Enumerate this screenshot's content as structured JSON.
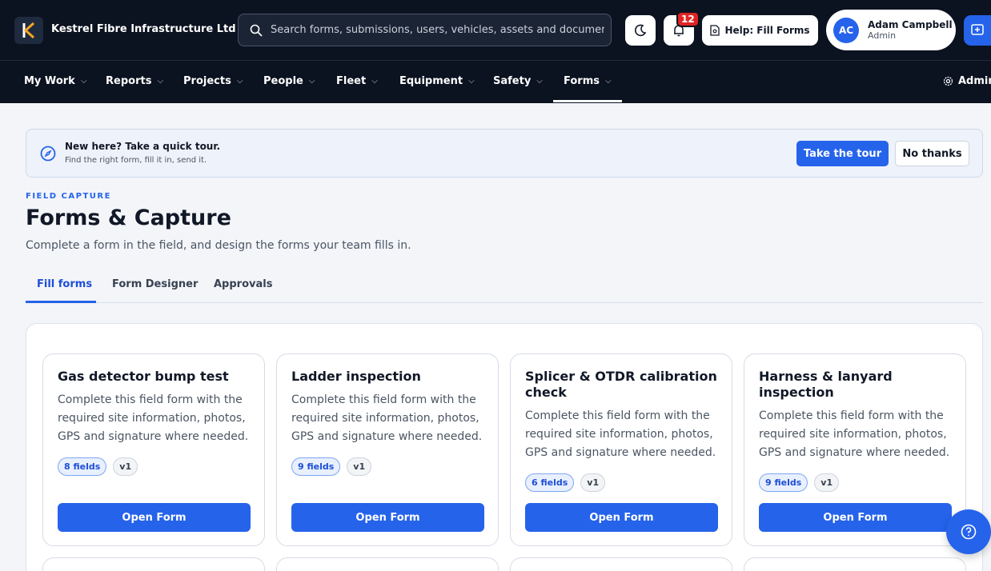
{
  "header": {
    "company": "Kestrel Fibre Infrastructure Ltd",
    "logo_letter": "K",
    "search_placeholder": "Search forms, submissions, users, vehicles, assets and documents",
    "notification_count": "12",
    "help_label": "Help: Fill Forms",
    "user": {
      "initials": "AC",
      "name": "Adam Campbell",
      "role": "Admin"
    }
  },
  "nav": {
    "items": [
      {
        "label": "My Work"
      },
      {
        "label": "Reports"
      },
      {
        "label": "Projects"
      },
      {
        "label": "People"
      },
      {
        "label": "Fleet"
      },
      {
        "label": "Equipment"
      },
      {
        "label": "Safety"
      },
      {
        "label": "Forms"
      }
    ],
    "active": "Forms",
    "admin_label": "Admin"
  },
  "banner": {
    "title": "New here? Take a quick tour.",
    "subtitle": "Find the right form, fill it in, send it.",
    "primary": "Take the tour",
    "secondary": "No thanks"
  },
  "page": {
    "eyebrow": "FIELD CAPTURE",
    "title": "Forms & Capture",
    "subtitle": "Complete a form in the field, and design the forms your team fills in."
  },
  "tabs": [
    {
      "label": "Fill forms",
      "active": true
    },
    {
      "label": "Form Designer",
      "active": false
    },
    {
      "label": "Approvals",
      "active": false
    }
  ],
  "cards": [
    {
      "title": "Gas detector bump test",
      "desc": "Complete this field form with the required site information, photos, GPS and signature where needed.",
      "fields": "8 fields",
      "version": "v1",
      "button": "Open Form"
    },
    {
      "title": "Ladder inspection",
      "desc": "Complete this field form with the required site information, photos, GPS and signature where needed.",
      "fields": "9 fields",
      "version": "v1",
      "button": "Open Form"
    },
    {
      "title": "Splicer & OTDR calibration check",
      "desc": "Complete this field form with the required site information, photos, GPS and signature where needed.",
      "fields": "6 fields",
      "version": "v1",
      "button": "Open Form"
    },
    {
      "title": "Harness & lanyard inspection",
      "desc": "Complete this field form with the required site information, photos, GPS and signature where needed.",
      "fields": "9 fields",
      "version": "v1",
      "button": "Open Form"
    }
  ],
  "colors": {
    "accent": "#2563eb",
    "topbar": "#0b1220",
    "badge": "#e02424"
  }
}
